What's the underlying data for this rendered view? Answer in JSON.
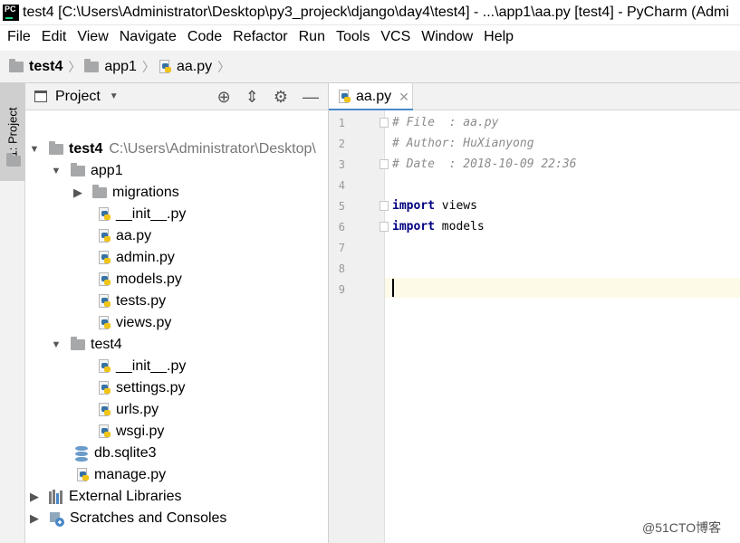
{
  "window": {
    "title": "test4 [C:\\Users\\Administrator\\Desktop\\py3_projeck\\django\\day4\\test4] - ...\\app1\\aa.py [test4] - PyCharm (Admi",
    "app_icon_text": "PC"
  },
  "menu": [
    "File",
    "Edit",
    "View",
    "Navigate",
    "Code",
    "Refactor",
    "Run",
    "Tools",
    "VCS",
    "Window",
    "Help"
  ],
  "breadcrumb": [
    "test4",
    "app1",
    "aa.py"
  ],
  "tool_window": {
    "tab_label": "1: Project",
    "header_title": "Project"
  },
  "tree": {
    "root": {
      "name": "test4",
      "path": "C:\\Users\\Administrator\\Desktop\\"
    },
    "app1": "app1",
    "migrations": "migrations",
    "app1_files": [
      "__init__.py",
      "aa.py",
      "admin.py",
      "models.py",
      "tests.py",
      "views.py"
    ],
    "test4": "test4",
    "test4_files": [
      "__init__.py",
      "settings.py",
      "urls.py",
      "wsgi.py"
    ],
    "db": "db.sqlite3",
    "manage": "manage.py",
    "external": "External Libraries",
    "scratches": "Scratches and Consoles"
  },
  "editor": {
    "tab": "aa.py",
    "line_numbers": [
      "1",
      "2",
      "3",
      "4",
      "5",
      "6",
      "7",
      "8",
      "9"
    ],
    "lines": {
      "l1": "# File  : aa.py",
      "l2": "# Author: HuXianyong",
      "l3": "# Date  : 2018-10-09 22:36",
      "l5_kw": "import",
      "l5_rest": " views",
      "l6_kw": "import",
      "l6_rest": " models"
    }
  },
  "watermark": "@51CTO博客"
}
